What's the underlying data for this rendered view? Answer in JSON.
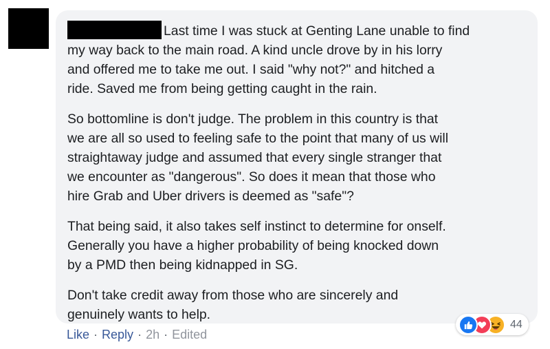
{
  "comment": {
    "paragraphs": [
      {
        "first_line_rest": "Last time I was stuck at Genting Lane unable to find",
        "lines": [
          "my way back to the main road. A kind uncle drove by in his lorry",
          "and offered me to take me out. I said \"why not?\" and hitched a",
          "ride. Saved me from being getting caught in the rain."
        ]
      },
      {
        "lines": [
          "So bottomline is don't judge. The problem in this country is that",
          "we are all so used to feeling safe to the point that many of us will",
          "straightaway judge and assumed that every single stranger that",
          "we encounter as \"dangerous\". So does it mean that those who",
          "hire Grab and Uber drivers is deemed as \"safe\"?"
        ]
      },
      {
        "lines": [
          "That being said, it also takes self instinct to determine for onself.",
          "Generally you have a higher probability of being knocked down",
          "by a PMD then being kidnapped in SG."
        ]
      },
      {
        "lines": [
          "Don't take credit away from those who are sincerely and",
          "genuinely wants to help."
        ]
      }
    ],
    "reactions": {
      "count": "44",
      "icons": [
        "like-icon",
        "love-icon",
        "haha-icon"
      ]
    },
    "actions": {
      "like_label": "Like",
      "reply_label": "Reply",
      "time": "2h",
      "edited": "Edited",
      "separator": "·"
    }
  },
  "colors": {
    "bubble_bg": "#f2f3f5",
    "text": "#1c1e21",
    "link": "#385898",
    "meta": "#90949c",
    "like": "#1877f2",
    "love": "#f33e58",
    "haha": "#f7b125"
  }
}
